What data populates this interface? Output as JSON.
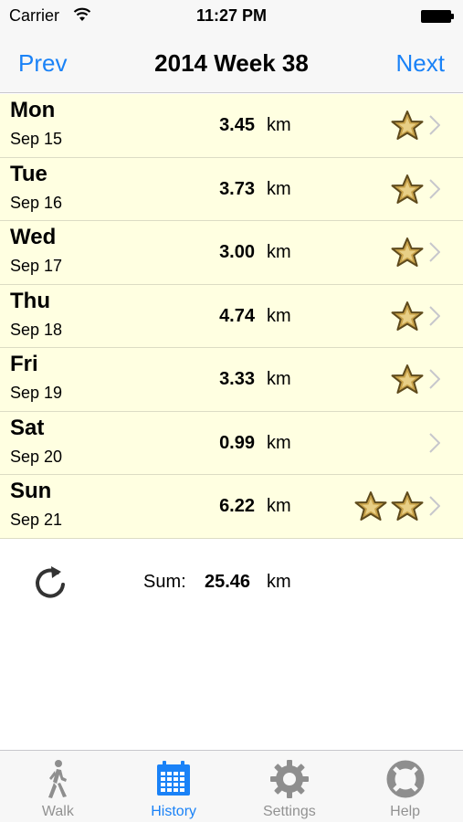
{
  "status_bar": {
    "carrier": "Carrier",
    "time": "11:27 PM"
  },
  "nav": {
    "prev": "Prev",
    "title": "2014 Week 38",
    "next": "Next"
  },
  "days": [
    {
      "day": "Mon",
      "date": "Sep 15",
      "distance": "3.45",
      "unit": "km",
      "stars": 1
    },
    {
      "day": "Tue",
      "date": "Sep 16",
      "distance": "3.73",
      "unit": "km",
      "stars": 1
    },
    {
      "day": "Wed",
      "date": "Sep 17",
      "distance": "3.00",
      "unit": "km",
      "stars": 1
    },
    {
      "day": "Thu",
      "date": "Sep 18",
      "distance": "4.74",
      "unit": "km",
      "stars": 1
    },
    {
      "day": "Fri",
      "date": "Sep 19",
      "distance": "3.33",
      "unit": "km",
      "stars": 1
    },
    {
      "day": "Sat",
      "date": "Sep 20",
      "distance": "0.99",
      "unit": "km",
      "stars": 0
    },
    {
      "day": "Sun",
      "date": "Sep 21",
      "distance": "6.22",
      "unit": "km",
      "stars": 2
    }
  ],
  "summary": {
    "label": "Sum:",
    "value": "25.46",
    "unit": "km"
  },
  "tabs": [
    {
      "label": "Walk",
      "icon": "walker-icon",
      "active": false
    },
    {
      "label": "History",
      "icon": "calendar-icon",
      "active": true
    },
    {
      "label": "Settings",
      "icon": "gear-icon",
      "active": false
    },
    {
      "label": "Help",
      "icon": "lifebuoy-icon",
      "active": false
    }
  ],
  "colors": {
    "accent": "#1a82f7",
    "row_background": "#ffffe1",
    "tab_inactive": "#929292",
    "star_gold": "#c9a34a"
  }
}
